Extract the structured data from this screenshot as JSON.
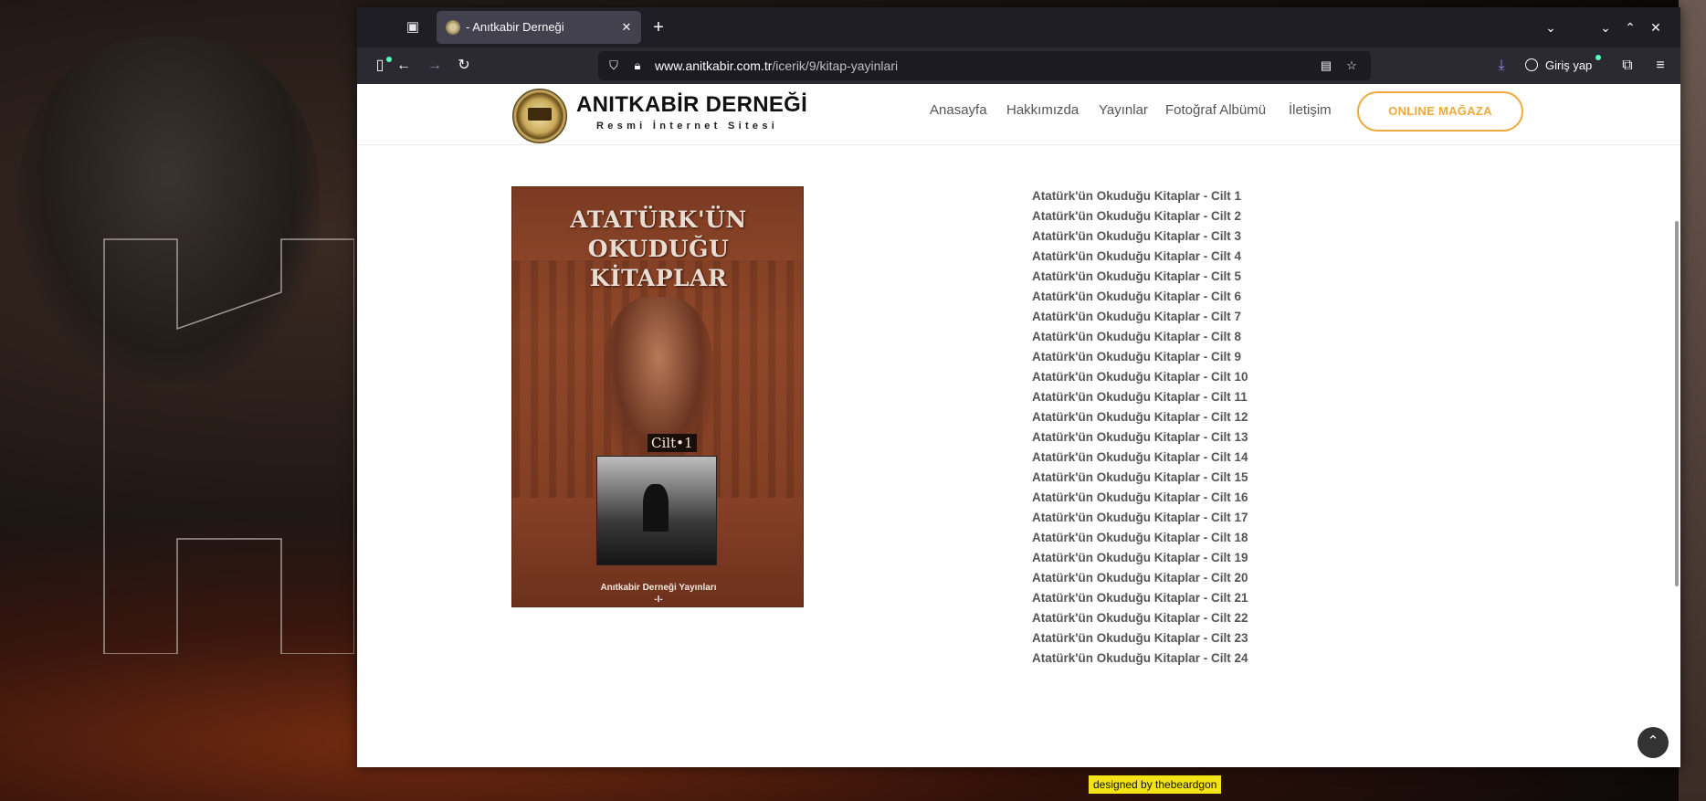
{
  "browser": {
    "tab": {
      "title": "- Anıtkabir Derneği"
    },
    "url": {
      "host": "www.anitkabir.com.tr",
      "path": "/icerik/9/kitap-yayinlari"
    },
    "signin_label": "Giriş yap"
  },
  "site": {
    "title": "ANITKABİR DERNEĞİ",
    "subtitle": "Resmi İnternet Sitesi",
    "menu": [
      "Anasayfa",
      "Hakkımızda",
      "Yayınlar",
      "Fotoğraf Albümü",
      "İletişim"
    ],
    "shop_button": "ONLINE MAĞAZA"
  },
  "cover": {
    "title_line1": "ATATÜRK'ÜN OKUDUĞU",
    "title_line2": "KİTAPLAR",
    "volume": "Cilt•1",
    "publisher": "Anıtkabir Derneği Yayınları",
    "number": "-I-"
  },
  "books": [
    "Atatürk'ün Okuduğu Kitaplar - Cilt 1",
    "Atatürk'ün Okuduğu Kitaplar - Cilt 2",
    "Atatürk'ün Okuduğu Kitaplar - Cilt 3",
    "Atatürk'ün Okuduğu Kitaplar - Cilt 4",
    "Atatürk'ün Okuduğu Kitaplar - Cilt 5",
    "Atatürk'ün Okuduğu Kitaplar - Cilt 6",
    "Atatürk'ün Okuduğu Kitaplar - Cilt 7",
    "Atatürk'ün Okuduğu Kitaplar - Cilt 8",
    "Atatürk'ün Okuduğu Kitaplar - Cilt 9",
    "Atatürk'ün Okuduğu Kitaplar - Cilt 10",
    "Atatürk'ün Okuduğu Kitaplar - Cilt 11",
    "Atatürk'ün Okuduğu Kitaplar - Cilt 12",
    "Atatürk'ün Okuduğu Kitaplar - Cilt 13",
    "Atatürk'ün Okuduğu Kitaplar - Cilt 14",
    "Atatürk'ün Okuduğu Kitaplar - Cilt 15",
    "Atatürk'ün Okuduğu Kitaplar - Cilt 16",
    "Atatürk'ün Okuduğu Kitaplar - Cilt 17",
    "Atatürk'ün Okuduğu Kitaplar - Cilt 18",
    "Atatürk'ün Okuduğu Kitaplar - Cilt 19",
    "Atatürk'ün Okuduğu Kitaplar - Cilt 20",
    "Atatürk'ün Okuduğu Kitaplar - Cilt 21",
    "Atatürk'ün Okuduğu Kitaplar - Cilt 22",
    "Atatürk'ün Okuduğu Kitaplar - Cilt 23",
    "Atatürk'ün Okuduğu Kitaplar - Cilt 24"
  ],
  "footer_credit": "designed by thebeardgon",
  "colors": {
    "accent": "#f0a93a",
    "link": "#555555",
    "credit_bg": "#f3e314"
  }
}
